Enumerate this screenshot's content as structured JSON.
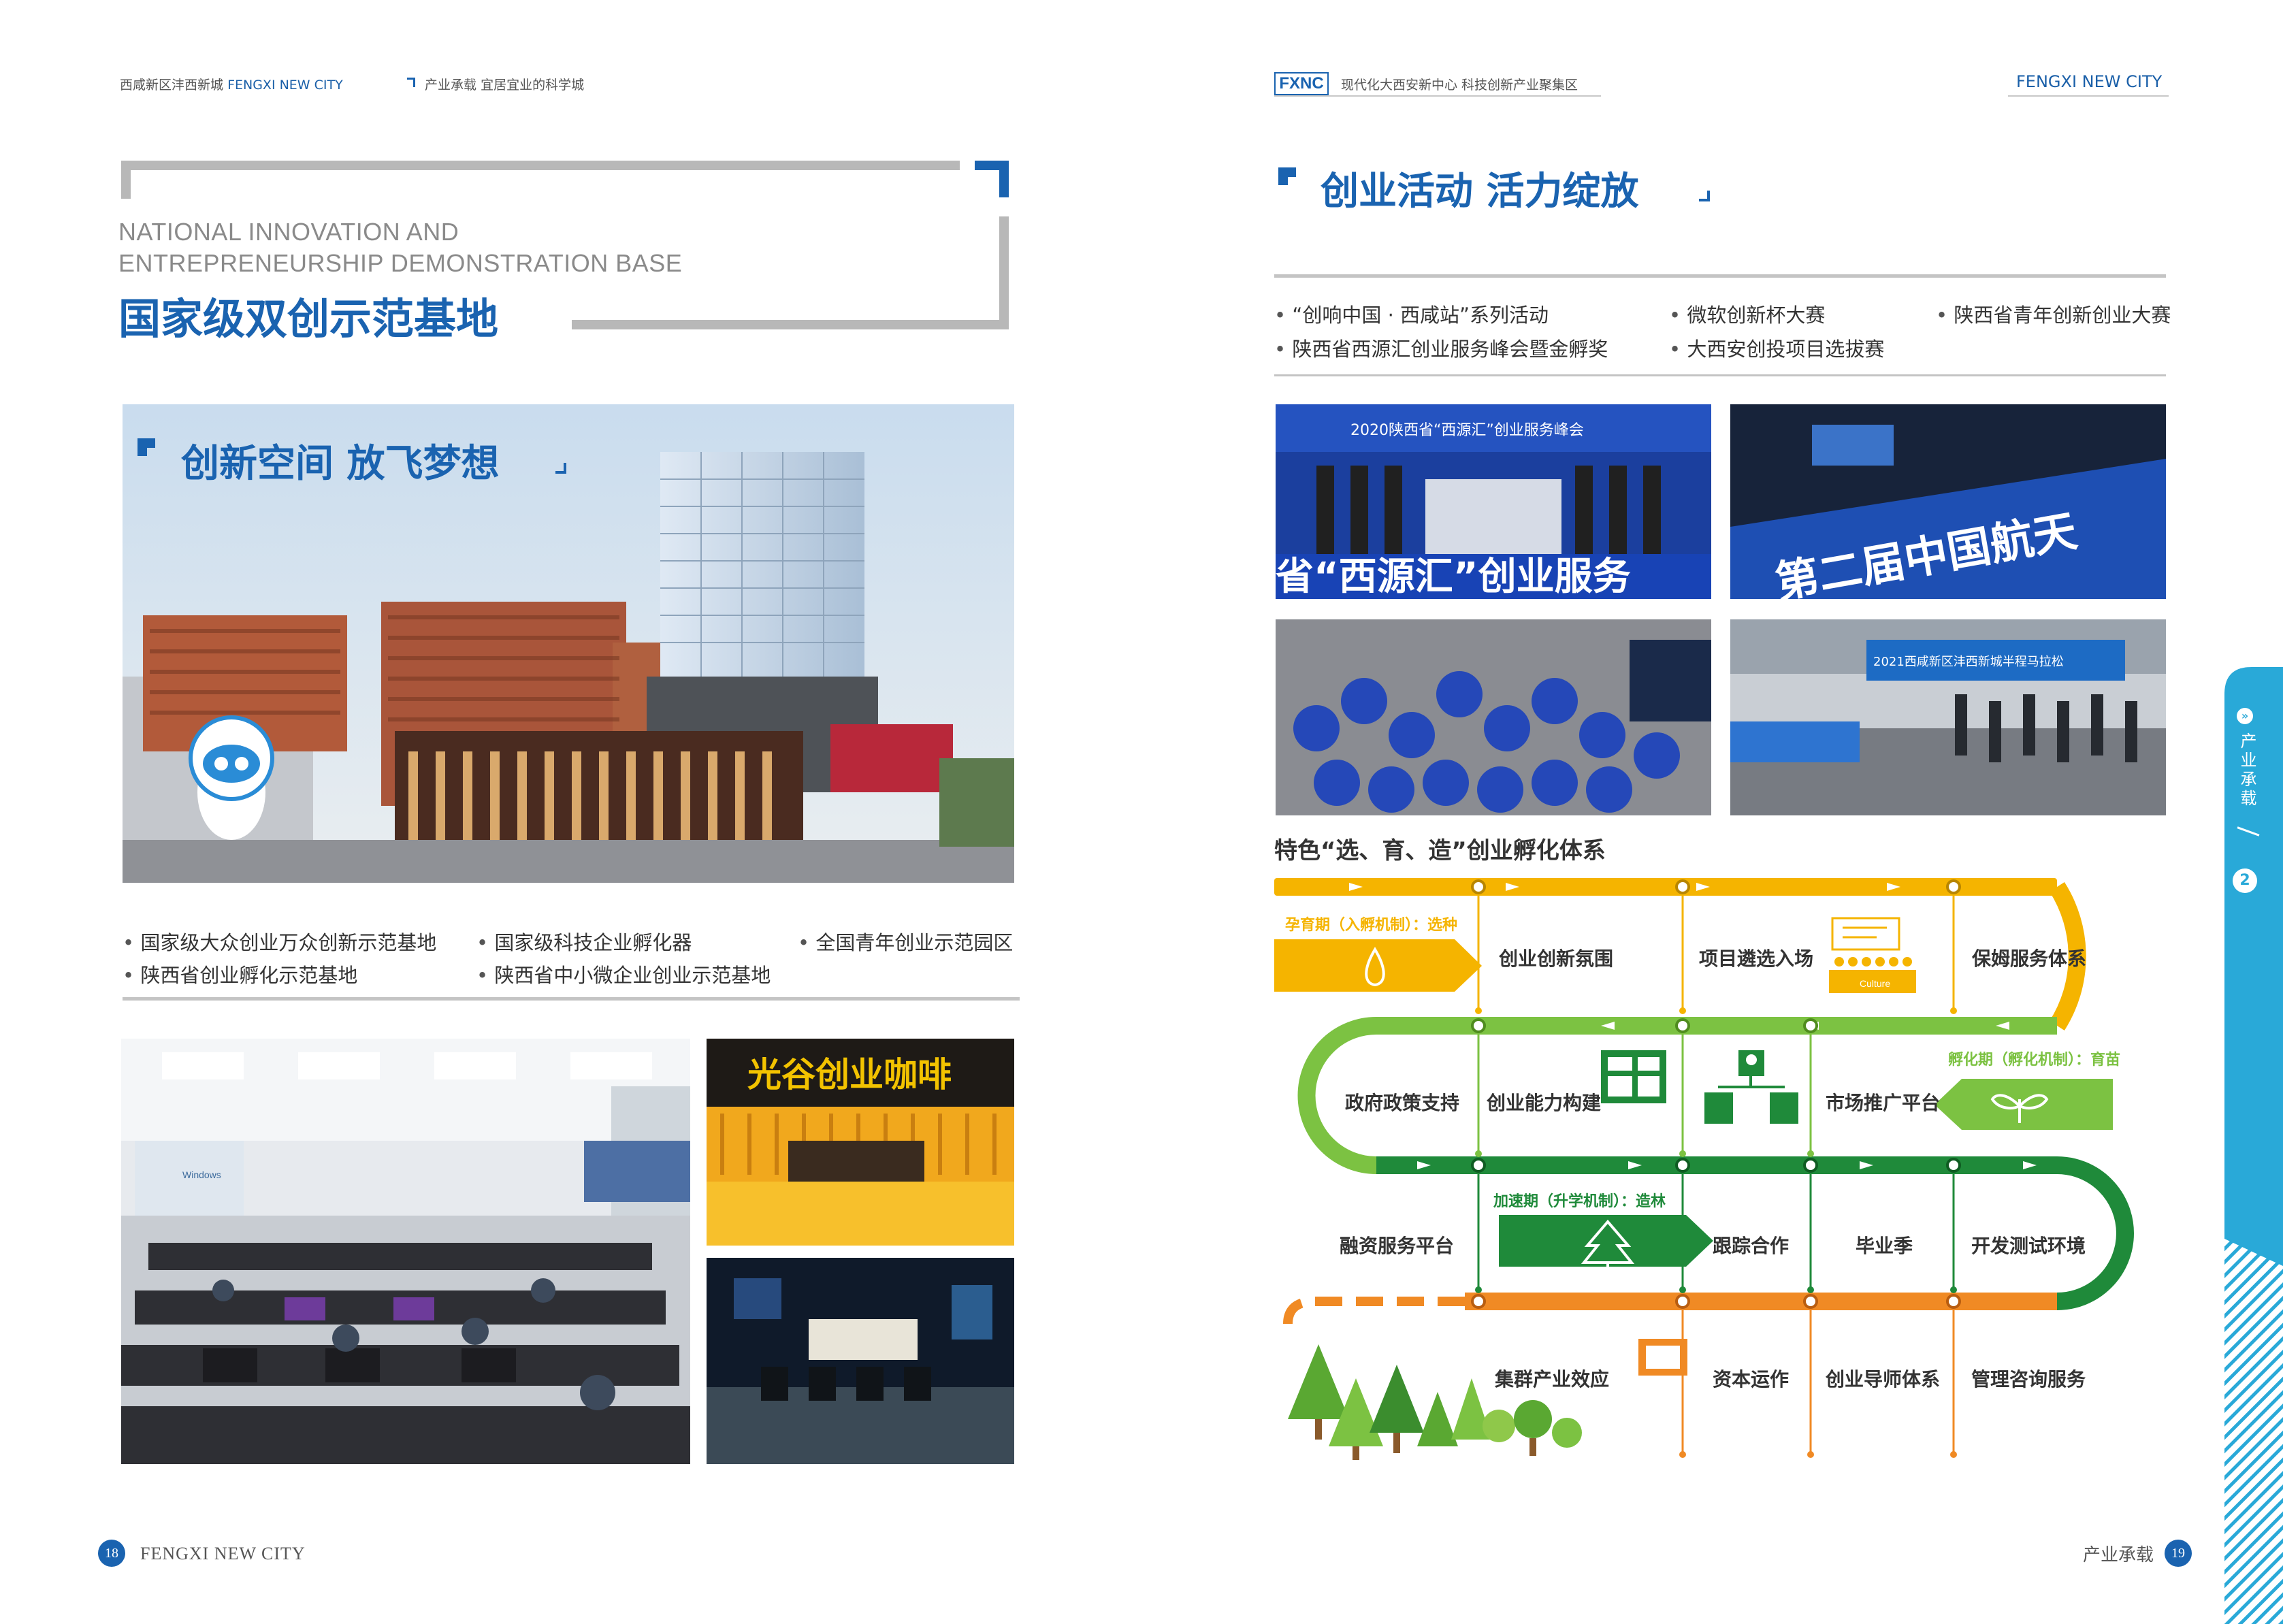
{
  "left_page": {
    "header": {
      "location": "西咸新区沣西新城",
      "en": "FENGXI NEW CITY",
      "section": "产业承载",
      "tagline": "宜居宜业的科学城"
    },
    "title_en_line1": "NATIONAL INNOVATION AND",
    "title_en_line2": "ENTREPRENEURSHIP DEMONSTRATION BASE",
    "title_cn": "国家级双创示范基地",
    "photo_section_title": "创新空间  放飞梦想",
    "bullets": [
      "国家级大众创业万众创新示范基地",
      "国家级科技企业孵化器",
      "全国青年创业示范园区",
      "陕西省创业孵化示范基地",
      "陕西省中小微企业创业示范基地"
    ],
    "cafe_sign": "光谷创业咖啡",
    "classroom_screen_text": "Windows",
    "footer": {
      "page_number": "18",
      "text": "FENGXI NEW CITY"
    }
  },
  "right_page": {
    "header": {
      "logo": "FXNC",
      "slogan": "现代化大西安新中心  科技创新产业聚集区",
      "en": "FENGXI NEW CITY"
    },
    "section_title": "创业活动  活力绽放",
    "bullets": [
      "“创响中国 · 西咸站”系列活动",
      "微软创新杯大赛",
      "陕西省青年创新创业大赛",
      "陕西省西源汇创业服务峰会暨金孵奖",
      "大西安创投项目选拔赛"
    ],
    "photo_texts": {
      "summit_banner": "省“西源汇”创业服务",
      "summit_top": "2020陕西省“西源汇”创业服务峰会",
      "aerospace_banner": "第二届中国航天",
      "marathon_banner": "2021西咸新区沣西新城半程马拉松"
    },
    "diagram": {
      "title": "特色“选、育、造”创业孵化体系",
      "stage1": "孕育期（入孵机制）：选种",
      "stage2": "孵化期（孵化机制）：育苗",
      "stage3": "加速期（升学机制）：造林",
      "row1": [
        "创业创新氛围",
        "项目遴选入场",
        "保姆服务体系"
      ],
      "row2": [
        "政府政策支持",
        "创业能力构建",
        "市场推广平台"
      ],
      "row3": [
        "融资服务平台",
        "跟踪合作",
        "毕业季",
        "开发测试环境"
      ],
      "row4": [
        "集群产业效应",
        "资本运作",
        "创业导师体系",
        "管理咨询服务"
      ],
      "culture_label": "Culture",
      "colors": {
        "yellow": "#f5b400",
        "light_green": "#7cc242",
        "dark_green": "#1f8a3a",
        "orange": "#f08a24"
      }
    },
    "side_tab": {
      "text": "产业承载",
      "number": "2"
    },
    "footer": {
      "text": "产业承载",
      "page_number": "19"
    }
  }
}
